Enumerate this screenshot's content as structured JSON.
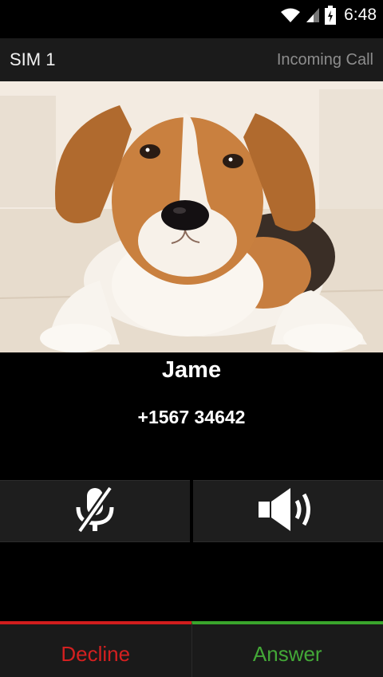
{
  "status_bar": {
    "time": "6:48",
    "icons": [
      "wifi-icon",
      "signal-icon",
      "battery-icon"
    ]
  },
  "call_header": {
    "sim": "SIM 1",
    "state": "Incoming Call"
  },
  "caller": {
    "name": "Jame",
    "number": "+1567 34642",
    "photo_icon": "beagle-photo"
  },
  "controls": {
    "mute_icon": "microphone-muted-icon",
    "speaker_icon": "speaker-icon"
  },
  "actions": {
    "decline_label": "Decline",
    "answer_label": "Answer",
    "decline_color": "#d42020",
    "answer_color": "#43a837"
  }
}
